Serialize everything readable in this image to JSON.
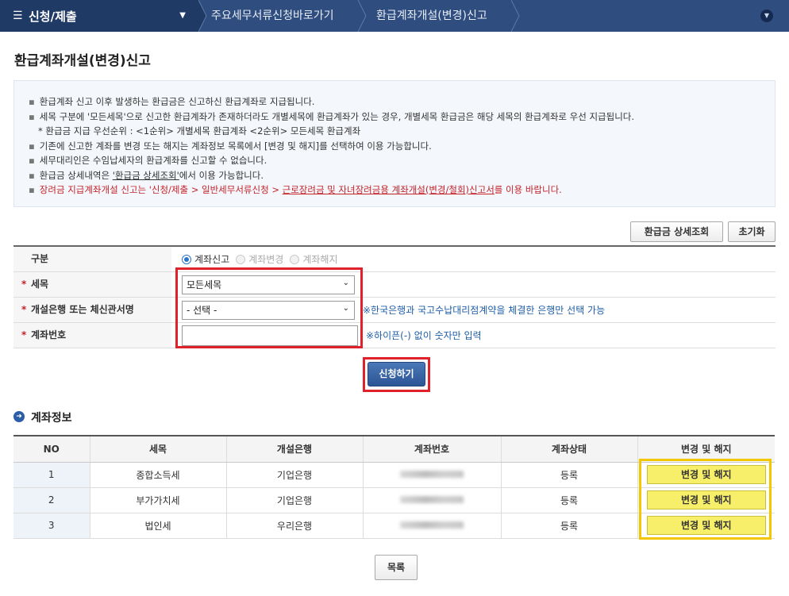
{
  "nav": {
    "menu_title": "신청/제출",
    "crumbs": [
      "주요세무서류신청바로가기",
      "환급계좌개설(변경)신고"
    ]
  },
  "page_title": "환급계좌개설(변경)신고",
  "info": {
    "lines": [
      "환급계좌 신고 이후 발생하는 환급금은 신고하신 환급계좌로 지급됩니다.",
      "세목 구분에 '모든세목'으로 신고한 환급계좌가 존재하더라도 개별세목에 환급계좌가 있는 경우, 개별세목 환급금은 해당 세목의 환급계좌로 우선 지급됩니다.",
      "* 환급금 지급 우선순위 : <1순위> 개별세목 환급계좌   <2순위> 모든세목 환급계좌",
      "기존에 신고한 계좌를 변경 또는 해지는 계좌정보 목록에서 [변경 및 해지]를 선택하여 이용 가능합니다.",
      "세무대리인은 수임납세자의 환급계좌를 신고할 수 없습니다.",
      "환급금 상세내역은 ",
      "'환급금 상세조회'",
      "에서 이용 가능합니다.",
      "장려금 지급계좌개설 신고는 '신청/제출 > 일반세무서류신청 > ",
      "근로장려금 및 자녀장려금용 계좌개설(변경/철회)신고서",
      "를 이용 바랍니다."
    ]
  },
  "buttons": {
    "refund_detail": "환급금 상세조회",
    "reset": "초기화",
    "submit": "신청하기",
    "list": "목록"
  },
  "form": {
    "type_label": "구분",
    "type_options": [
      "계좌신고",
      "계좌변경",
      "계좌해지"
    ],
    "tax_label": "세목",
    "tax_value": "모든세목",
    "bank_label": "개설은행 또는 체신관서명",
    "bank_value": "- 선택 -",
    "bank_hint": "※한국은행과 국고수납대리점계약을 체결한 은행만 선택 가능",
    "account_label": "계좌번호",
    "account_value": "",
    "account_hint": "※하이픈(-) 없이 숫자만 입력",
    "req_mark": "*"
  },
  "section": {
    "title": "계좌정보"
  },
  "table": {
    "headers": [
      "NO",
      "세목",
      "개설은행",
      "계좌번호",
      "계좌상태",
      "변경 및 해지"
    ],
    "rows": [
      {
        "no": "1",
        "tax": "종합소득세",
        "bank": "기업은행",
        "status": "등록",
        "action": "변경 및 해지"
      },
      {
        "no": "2",
        "tax": "부가가치세",
        "bank": "기업은행",
        "status": "등록",
        "action": "변경 및 해지"
      },
      {
        "no": "3",
        "tax": "법인세",
        "bank": "우리은행",
        "status": "등록",
        "action": "변경 및 해지"
      }
    ]
  },
  "colors": {
    "nav": "#2f4d7e",
    "nav_dark": "#203a66",
    "highlight_red": "#e0202a",
    "highlight_yellow": "#f2c700",
    "notice_red": "#c3232a",
    "hint_blue": "#1e5ea8"
  },
  "icons": {
    "menu": "hamburger-icon",
    "caret": "caret-down-icon",
    "nav_toggle": "chevron-down-icon",
    "section": "arrow-right-circle-icon"
  }
}
